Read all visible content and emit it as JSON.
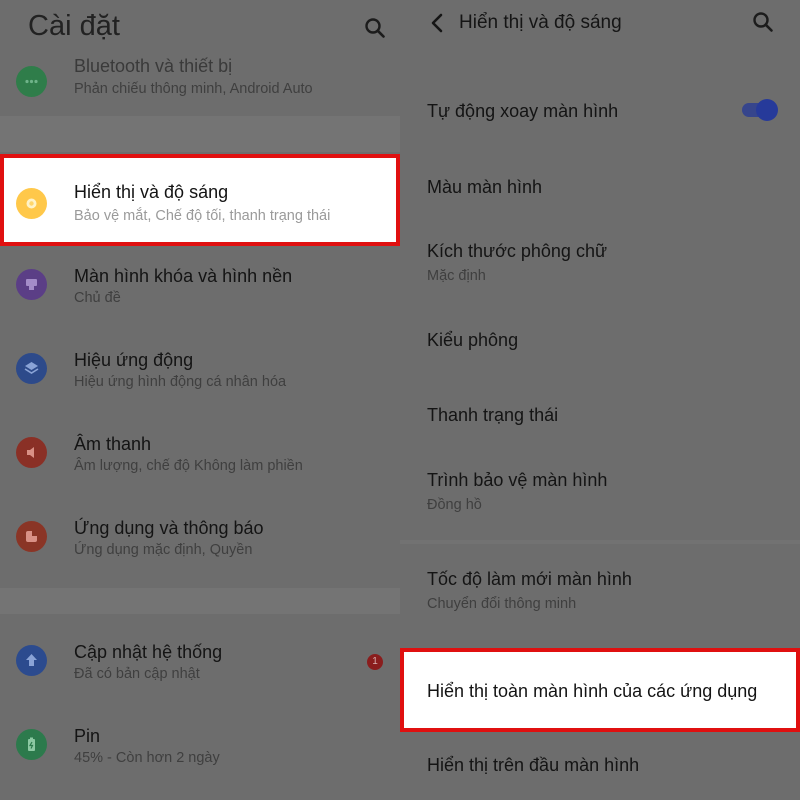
{
  "left": {
    "title": "Cài đặt",
    "items": [
      {
        "title": "Bluetooth và thiết bị",
        "subtitle": "Phản chiếu thông minh, Android Auto"
      },
      {
        "title": "Hiển thị và độ sáng",
        "subtitle": "Bảo vệ mắt, Chế độ tối, thanh trạng thái"
      },
      {
        "title": "Màn hình khóa và hình nền",
        "subtitle": "Chủ đề"
      },
      {
        "title": "Hiệu ứng động",
        "subtitle": "Hiệu ứng hình động cá nhân hóa"
      },
      {
        "title": "Âm thanh",
        "subtitle": "Âm lượng, chế độ Không làm phiền"
      },
      {
        "title": "Ứng dụng và thông báo",
        "subtitle": "Ứng dụng mặc định, Quyền"
      },
      {
        "title": "Cập nhật hệ thống",
        "subtitle": "Đã có bản cập nhật",
        "badge": "1"
      },
      {
        "title": "Pin",
        "subtitle": "45% - Còn hơn 2 ngày"
      }
    ]
  },
  "right": {
    "title": "Hiển thị và độ sáng",
    "items": [
      {
        "title": "Tự động xoay màn hình",
        "toggle": true
      },
      {
        "title": "Màu màn hình"
      },
      {
        "title": "Kích thước phông chữ",
        "subtitle": "Mặc định"
      },
      {
        "title": "Kiểu phông"
      },
      {
        "title": "Thanh trạng thái"
      },
      {
        "title": "Trình bảo vệ màn hình",
        "subtitle": "Đồng hồ"
      },
      {
        "title": "Tốc độ làm mới màn hình",
        "subtitle": "Chuyển đổi thông minh"
      },
      {
        "title": "Hiển thị toàn màn hình của các ứng dụng"
      },
      {
        "title": "Hiển thị trên đầu màn hình"
      }
    ]
  },
  "colors": {
    "highlight_border": "#e01010",
    "toggle_on": "#263a9a",
    "icon_bluetooth": "#2f7d4a",
    "icon_display": "#ffc84a",
    "icon_lockscreen": "#5b3e86",
    "icon_animation": "#2d4a8a",
    "icon_sound": "#8a3026",
    "icon_apps": "#8a3526",
    "icon_update": "#2c4b8e",
    "icon_battery": "#2c7a4c"
  },
  "icons": [
    "search-icon",
    "bluetooth-icon",
    "display-brightness-icon",
    "wallpaper-icon",
    "animation-icon",
    "sound-icon",
    "apps-icon",
    "system-update-icon",
    "battery-icon",
    "back-arrow-icon"
  ]
}
